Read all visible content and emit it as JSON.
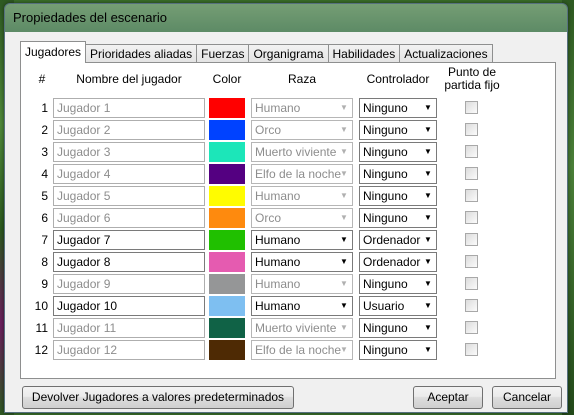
{
  "window": {
    "title": "Propiedades del escenario"
  },
  "tabs": [
    {
      "label": "Jugadores"
    },
    {
      "label": "Prioridades aliadas"
    },
    {
      "label": "Fuerzas"
    },
    {
      "label": "Organigrama"
    },
    {
      "label": "Habilidades"
    },
    {
      "label": "Actualizaciones"
    }
  ],
  "headers": {
    "num": "#",
    "name": "Nombre del jugador",
    "color": "Color",
    "race": "Raza",
    "controller": "Controlador",
    "fixed_start_line1": "Punto de",
    "fixed_start_line2": "partida fijo"
  },
  "players": [
    {
      "num": "1",
      "name": "Jugador 1",
      "color": "#ff0000",
      "race": "Humano",
      "controller": "Ninguno",
      "enabled": false
    },
    {
      "num": "2",
      "name": "Jugador 2",
      "color": "#0042ff",
      "race": "Orco",
      "controller": "Ninguno",
      "enabled": false
    },
    {
      "num": "3",
      "name": "Jugador 3",
      "color": "#1ce6b9",
      "race": "Muerto viviente",
      "controller": "Ninguno",
      "enabled": false
    },
    {
      "num": "4",
      "name": "Jugador 4",
      "color": "#540081",
      "race": "Elfo de la noche",
      "controller": "Ninguno",
      "enabled": false
    },
    {
      "num": "5",
      "name": "Jugador 5",
      "color": "#fffc00",
      "race": "Humano",
      "controller": "Ninguno",
      "enabled": false
    },
    {
      "num": "6",
      "name": "Jugador 6",
      "color": "#fe8a0e",
      "race": "Orco",
      "controller": "Ninguno",
      "enabled": false
    },
    {
      "num": "7",
      "name": "Jugador 7",
      "color": "#20c000",
      "race": "Humano",
      "controller": "Ordenador",
      "enabled": true
    },
    {
      "num": "8",
      "name": "Jugador 8",
      "color": "#e55bb0",
      "race": "Humano",
      "controller": "Ordenador",
      "enabled": true
    },
    {
      "num": "9",
      "name": "Jugador 9",
      "color": "#959697",
      "race": "Humano",
      "controller": "Ninguno",
      "enabled": false
    },
    {
      "num": "10",
      "name": "Jugador 10",
      "color": "#7ebff1",
      "race": "Humano",
      "controller": "Usuario",
      "enabled": true
    },
    {
      "num": "11",
      "name": "Jugador 11",
      "color": "#106246",
      "race": "Muerto viviente",
      "controller": "Ninguno",
      "enabled": false
    },
    {
      "num": "12",
      "name": "Jugador 12",
      "color": "#4e2a04",
      "race": "Elfo de la noche",
      "controller": "Ninguno",
      "enabled": false
    }
  ],
  "buttons": {
    "reset": "Devolver Jugadores a valores predeterminados",
    "ok": "Aceptar",
    "cancel": "Cancelar"
  }
}
